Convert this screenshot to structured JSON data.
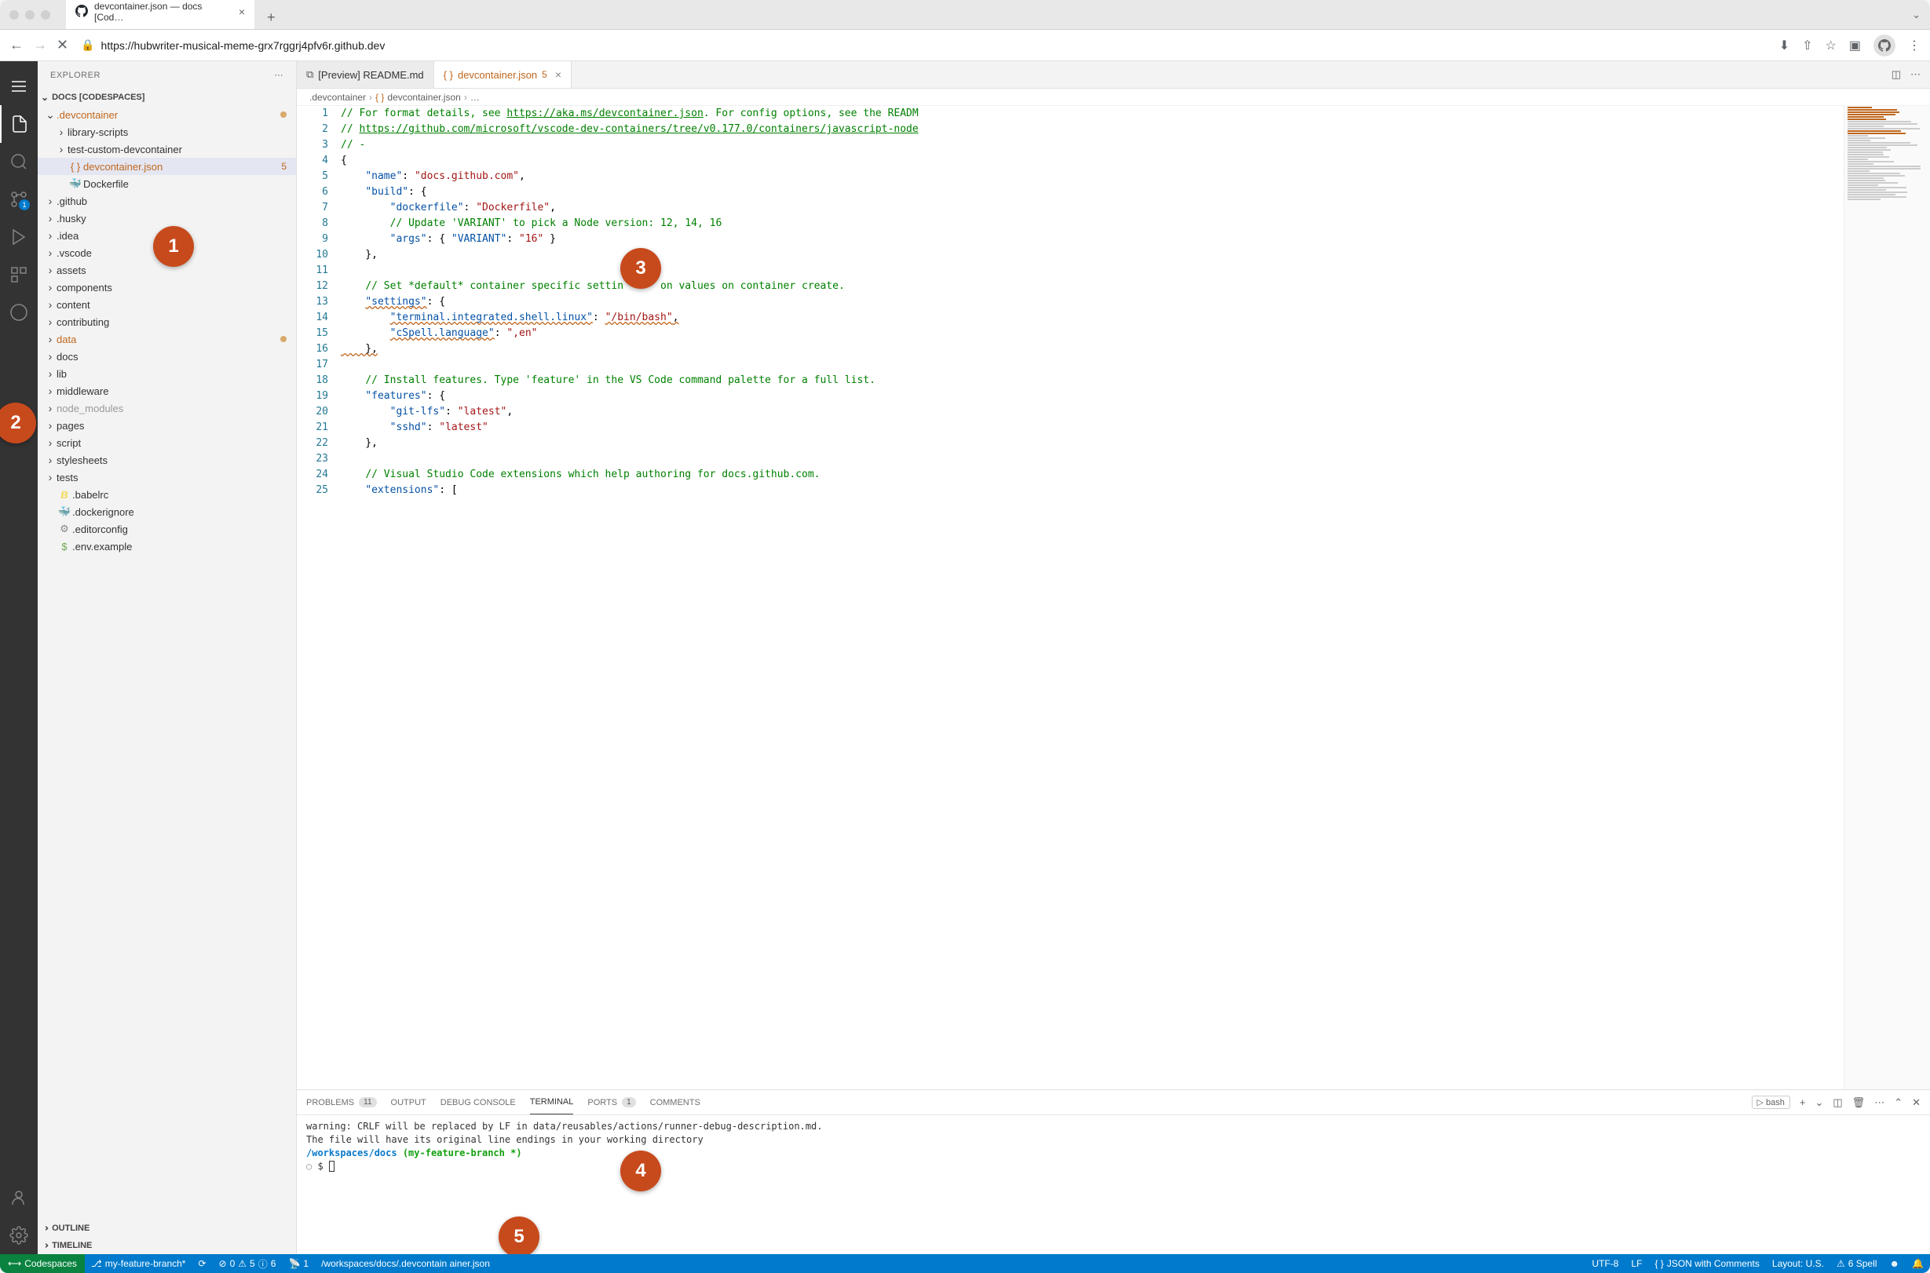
{
  "browser": {
    "tab_title": "devcontainer.json — docs [Cod…",
    "url": "https://hubwriter-musical-meme-grx7rggrj4pfv6r.github.dev"
  },
  "sidebar": {
    "title": "EXPLORER",
    "workspace": "DOCS [CODESPACES]",
    "outline": "OUTLINE",
    "timeline": "TIMELINE",
    "tree": [
      {
        "label": ".devcontainer",
        "type": "folder",
        "indent": 0,
        "expanded": true,
        "modified": true
      },
      {
        "label": "library-scripts",
        "type": "folder",
        "indent": 1,
        "expanded": false
      },
      {
        "label": "test-custom-devcontainer",
        "type": "folder",
        "indent": 1,
        "expanded": false
      },
      {
        "label": "devcontainer.json",
        "type": "file",
        "indent": 1,
        "icon": "json",
        "selected": true,
        "modified": true,
        "badge": "5"
      },
      {
        "label": "Dockerfile",
        "type": "file",
        "indent": 1,
        "icon": "docker"
      },
      {
        "label": ".github",
        "type": "folder",
        "indent": 0,
        "expanded": false
      },
      {
        "label": ".husky",
        "type": "folder",
        "indent": 0,
        "expanded": false
      },
      {
        "label": ".idea",
        "type": "folder",
        "indent": 0,
        "expanded": false
      },
      {
        "label": ".vscode",
        "type": "folder",
        "indent": 0,
        "expanded": false
      },
      {
        "label": "assets",
        "type": "folder",
        "indent": 0,
        "expanded": false
      },
      {
        "label": "components",
        "type": "folder",
        "indent": 0,
        "expanded": false
      },
      {
        "label": "content",
        "type": "folder",
        "indent": 0,
        "expanded": false
      },
      {
        "label": "contributing",
        "type": "folder",
        "indent": 0,
        "expanded": false
      },
      {
        "label": "data",
        "type": "folder",
        "indent": 0,
        "expanded": false,
        "modified": true
      },
      {
        "label": "docs",
        "type": "folder",
        "indent": 0,
        "expanded": false
      },
      {
        "label": "lib",
        "type": "folder",
        "indent": 0,
        "expanded": false
      },
      {
        "label": "middleware",
        "type": "folder",
        "indent": 0,
        "expanded": false
      },
      {
        "label": "node_modules",
        "type": "folder",
        "indent": 0,
        "expanded": false,
        "dimmed": true
      },
      {
        "label": "pages",
        "type": "folder",
        "indent": 0,
        "expanded": false
      },
      {
        "label": "script",
        "type": "folder",
        "indent": 0,
        "expanded": false
      },
      {
        "label": "stylesheets",
        "type": "folder",
        "indent": 0,
        "expanded": false
      },
      {
        "label": "tests",
        "type": "folder",
        "indent": 0,
        "expanded": false
      },
      {
        "label": ".babelrc",
        "type": "file",
        "indent": 0,
        "icon": "babel"
      },
      {
        "label": ".dockerignore",
        "type": "file",
        "indent": 0,
        "icon": "docker"
      },
      {
        "label": ".editorconfig",
        "type": "file",
        "indent": 0,
        "icon": "gear"
      },
      {
        "label": ".env.example",
        "type": "file",
        "indent": 0,
        "icon": "env"
      }
    ]
  },
  "editor": {
    "tabs": [
      {
        "label": "[Preview] README.md",
        "icon": "preview",
        "active": false
      },
      {
        "label": "devcontainer.json",
        "icon": "json",
        "active": true,
        "modified": true,
        "badge": "5"
      }
    ],
    "breadcrumbs": [
      ".devcontainer",
      "devcontainer.json",
      "…"
    ],
    "lines": [
      {
        "n": 1,
        "segments": [
          {
            "t": "// For format details, see ",
            "c": "c-comment"
          },
          {
            "t": "https://aka.ms/devcontainer.json",
            "c": "c-link"
          },
          {
            "t": ". For config options, see the READM",
            "c": "c-comment"
          }
        ]
      },
      {
        "n": 2,
        "segments": [
          {
            "t": "// ",
            "c": "c-comment"
          },
          {
            "t": "https://github.com/microsoft/vscode-dev-containers/tree/v0.177.0/containers/javascript-node",
            "c": "c-link"
          }
        ]
      },
      {
        "n": 3,
        "segments": [
          {
            "t": "// -",
            "c": "c-comment"
          }
        ]
      },
      {
        "n": 4,
        "segments": [
          {
            "t": "{",
            "c": "c-punct"
          }
        ]
      },
      {
        "n": 5,
        "segments": [
          {
            "t": "    ",
            "c": ""
          },
          {
            "t": "\"name\"",
            "c": "c-key"
          },
          {
            "t": ": ",
            "c": "c-punct"
          },
          {
            "t": "\"docs.github.com\"",
            "c": "c-string"
          },
          {
            "t": ",",
            "c": "c-punct"
          }
        ]
      },
      {
        "n": 6,
        "segments": [
          {
            "t": "    ",
            "c": ""
          },
          {
            "t": "\"build\"",
            "c": "c-key"
          },
          {
            "t": ": {",
            "c": "c-punct"
          }
        ]
      },
      {
        "n": 7,
        "segments": [
          {
            "t": "        ",
            "c": ""
          },
          {
            "t": "\"dockerfile\"",
            "c": "c-key"
          },
          {
            "t": ": ",
            "c": "c-punct"
          },
          {
            "t": "\"Dockerfile\"",
            "c": "c-string"
          },
          {
            "t": ",",
            "c": "c-punct"
          }
        ]
      },
      {
        "n": 8,
        "segments": [
          {
            "t": "        ",
            "c": ""
          },
          {
            "t": "// Update 'VARIANT' to pick a Node version: 12, 14, 16",
            "c": "c-comment"
          }
        ]
      },
      {
        "n": 9,
        "segments": [
          {
            "t": "        ",
            "c": ""
          },
          {
            "t": "\"args\"",
            "c": "c-key"
          },
          {
            "t": ": { ",
            "c": "c-punct"
          },
          {
            "t": "\"VARIANT\"",
            "c": "c-key"
          },
          {
            "t": ": ",
            "c": "c-punct"
          },
          {
            "t": "\"16\"",
            "c": "c-string"
          },
          {
            "t": " }",
            "c": "c-punct"
          }
        ]
      },
      {
        "n": 10,
        "segments": [
          {
            "t": "    },",
            "c": "c-punct"
          }
        ]
      },
      {
        "n": 11,
        "segments": []
      },
      {
        "n": 12,
        "segments": [
          {
            "t": "    ",
            "c": ""
          },
          {
            "t": "// Set *default* container specific settin      on values on container create.",
            "c": "c-comment"
          }
        ]
      },
      {
        "n": 13,
        "segments": [
          {
            "t": "    ",
            "c": ""
          },
          {
            "t": "\"settings\"",
            "c": "c-key squiggle"
          },
          {
            "t": ": {",
            "c": "c-punct"
          }
        ]
      },
      {
        "n": 14,
        "segments": [
          {
            "t": "        ",
            "c": ""
          },
          {
            "t": "\"terminal.integrated.shell.linux\"",
            "c": "c-key squiggle"
          },
          {
            "t": ": ",
            "c": "c-punct"
          },
          {
            "t": "\"/bin/bash\"",
            "c": "c-string squiggle"
          },
          {
            "t": ",",
            "c": "c-punct squiggle"
          }
        ]
      },
      {
        "n": 15,
        "segments": [
          {
            "t": "        ",
            "c": ""
          },
          {
            "t": "\"cSpell.language\"",
            "c": "c-key squiggle"
          },
          {
            "t": ": ",
            "c": "c-punct"
          },
          {
            "t": "\",en\"",
            "c": "c-string"
          }
        ]
      },
      {
        "n": 16,
        "segments": [
          {
            "t": "    },",
            "c": "c-punct squiggle"
          }
        ]
      },
      {
        "n": 17,
        "segments": []
      },
      {
        "n": 18,
        "segments": [
          {
            "t": "    ",
            "c": ""
          },
          {
            "t": "// Install features. Type 'feature' in the VS Code command palette for a full list.",
            "c": "c-comment"
          }
        ]
      },
      {
        "n": 19,
        "segments": [
          {
            "t": "    ",
            "c": ""
          },
          {
            "t": "\"features\"",
            "c": "c-key"
          },
          {
            "t": ": {",
            "c": "c-punct"
          }
        ]
      },
      {
        "n": 20,
        "segments": [
          {
            "t": "        ",
            "c": ""
          },
          {
            "t": "\"git-lfs\"",
            "c": "c-key"
          },
          {
            "t": ": ",
            "c": "c-punct"
          },
          {
            "t": "\"latest\"",
            "c": "c-string"
          },
          {
            "t": ",",
            "c": "c-punct"
          }
        ]
      },
      {
        "n": 21,
        "segments": [
          {
            "t": "        ",
            "c": ""
          },
          {
            "t": "\"sshd\"",
            "c": "c-key"
          },
          {
            "t": ": ",
            "c": "c-punct"
          },
          {
            "t": "\"latest\"",
            "c": "c-string"
          }
        ]
      },
      {
        "n": 22,
        "segments": [
          {
            "t": "    },",
            "c": "c-punct"
          }
        ]
      },
      {
        "n": 23,
        "segments": []
      },
      {
        "n": 24,
        "segments": [
          {
            "t": "    ",
            "c": ""
          },
          {
            "t": "// Visual Studio Code extensions which help authoring for docs.github.com.",
            "c": "c-comment"
          }
        ]
      },
      {
        "n": 25,
        "segments": [
          {
            "t": "    ",
            "c": ""
          },
          {
            "t": "\"extensions\"",
            "c": "c-key"
          },
          {
            "t": ": [",
            "c": "c-punct"
          }
        ]
      }
    ]
  },
  "panel": {
    "tabs": {
      "problems": "PROBLEMS",
      "problems_count": "11",
      "output": "OUTPUT",
      "debug": "DEBUG CONSOLE",
      "terminal": "TERMINAL",
      "ports": "PORTS",
      "ports_count": "1",
      "comments": "COMMENTS"
    },
    "shell_label": "bash",
    "terminal": {
      "warning_line1": "warning: CRLF will be replaced by LF in data/reusables/actions/runner-debug-description.md.",
      "warning_line2": "The file will have its original line endings in your working directory",
      "path": "/workspaces/docs",
      "branch": "(my-feature-branch *)",
      "prompt": "$ "
    }
  },
  "statusbar": {
    "remote": "Codespaces",
    "branch": "my-feature-branch*",
    "sync": "⟳",
    "errors": "0",
    "warnings": "5",
    "infos": "6",
    "ports": "1",
    "path": "/workspaces/docs/.devcontain          ainer.json",
    "encoding": "UTF-8",
    "eol": "LF",
    "language": "JSON with Comments",
    "layout": "Layout: U.S.",
    "spell": "6 Spell"
  },
  "callouts": [
    "1",
    "2",
    "3",
    "4",
    "5"
  ]
}
